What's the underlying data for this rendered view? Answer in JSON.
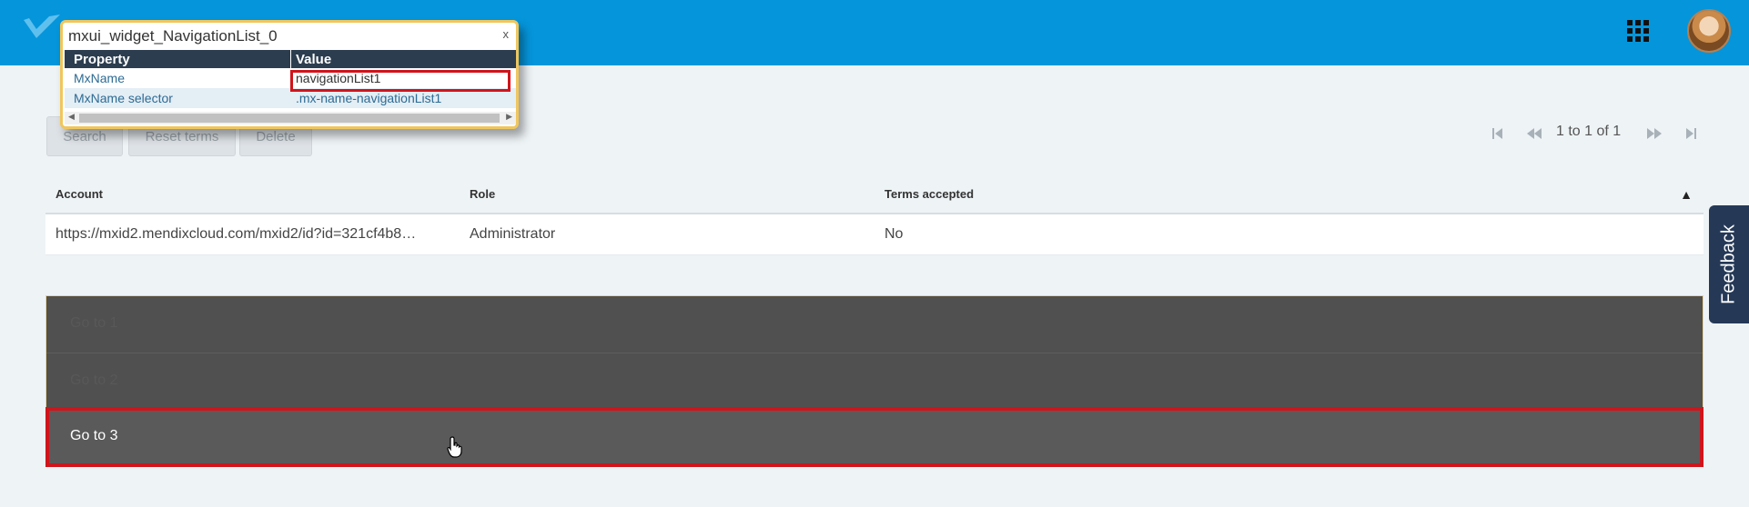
{
  "colors": {
    "topbar": "#0595db",
    "highlight": "#d0141b",
    "navlist": "#505050",
    "feedback": "#253957"
  },
  "toolbar": {
    "search_label": "Search",
    "reset_terms_label": "Reset terms",
    "delete_label": "Delete"
  },
  "pager": {
    "first_icon": "first-page-icon",
    "prev_icon": "previous-page-icon",
    "text": "1 to 1 of 1",
    "next_icon": "next-page-icon",
    "last_icon": "last-page-icon"
  },
  "grid": {
    "columns": [
      "Account",
      "Role",
      "Terms accepted"
    ],
    "sort_indicator": "▲",
    "rows": [
      {
        "account": "https://mxid2.mendixcloud.com/mxid2/id?id=321cf4b8…",
        "role": "Administrator",
        "terms": "No"
      }
    ]
  },
  "navlist": {
    "items": [
      {
        "label": "Go to 1"
      },
      {
        "label": "Go to 2"
      },
      {
        "label": "Go to 3"
      }
    ]
  },
  "feedback": {
    "label": "Feedback"
  },
  "inspector": {
    "title": "mxui_widget_NavigationList_0",
    "close": "x",
    "headers": {
      "property": "Property",
      "value": "Value"
    },
    "rows": [
      {
        "property": "MxName",
        "value": "navigationList1"
      },
      {
        "property": "MxName selector",
        "value": ".mx-name-navigationList1"
      }
    ]
  }
}
